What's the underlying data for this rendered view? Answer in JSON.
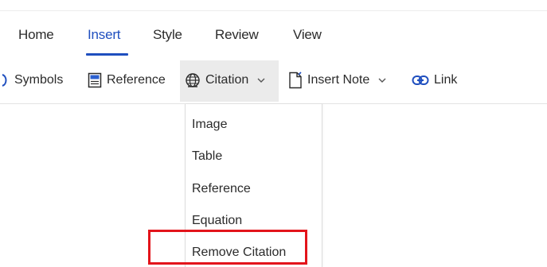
{
  "tabs": [
    {
      "label": "Home"
    },
    {
      "label": "Insert",
      "active": true
    },
    {
      "label": "Style"
    },
    {
      "label": "Review"
    },
    {
      "label": "View"
    }
  ],
  "ribbon": {
    "symbols_label": "Symbols",
    "reference_label": "Reference",
    "citation_label": "Citation",
    "insert_note_label": "Insert Note",
    "link_label": "Link"
  },
  "dropdown": {
    "items": [
      "Image",
      "Table",
      "Reference",
      "Equation",
      "Remove Citation"
    ]
  },
  "colors": {
    "accent": "#1f4fbf",
    "highlight_border": "#e3141b",
    "ribbon_hover": "#ebebeb"
  },
  "icons": {
    "symbols": "omega-icon",
    "reference": "book-icon",
    "citation": "globe-icon",
    "insert_note": "document-icon",
    "link": "link-icon"
  }
}
